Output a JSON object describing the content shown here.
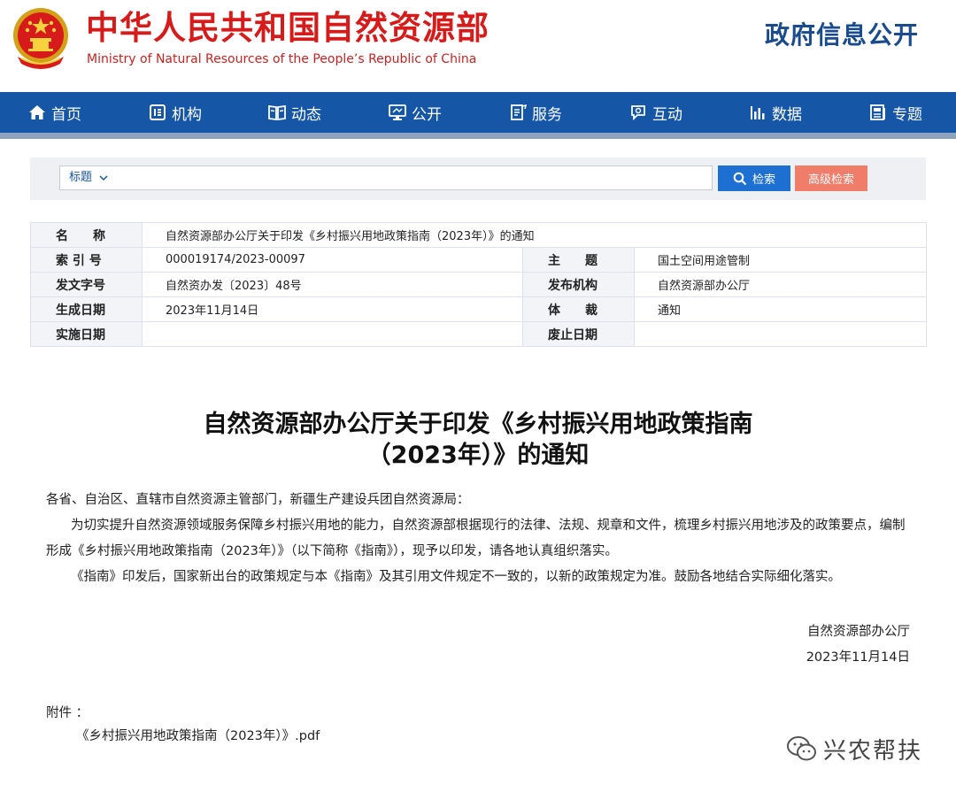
{
  "header": {
    "title_cn": "中华人民共和国自然资源部",
    "title_en": "Ministry of Natural Resources of the People’s Republic of China",
    "gov_info": "政府信息公开"
  },
  "nav": {
    "items": [
      {
        "label": "首页",
        "icon": "home-icon"
      },
      {
        "label": "机构",
        "icon": "org-icon"
      },
      {
        "label": "动态",
        "icon": "book-icon"
      },
      {
        "label": "公开",
        "icon": "monitor-icon"
      },
      {
        "label": "服务",
        "icon": "document-icon"
      },
      {
        "label": "互动",
        "icon": "chat-icon"
      },
      {
        "label": "数据",
        "icon": "bar-chart-icon"
      },
      {
        "label": "专题",
        "icon": "topic-icon"
      }
    ]
  },
  "search": {
    "select_value": "标题",
    "input_value": "",
    "search_label": "检索",
    "advanced_label": "高级检索"
  },
  "meta": {
    "name_label": "名　　称",
    "name_value": "自然资源部办公厅关于印发《乡村振兴用地政策指南（2023年）》的通知",
    "index_label": "索 引 号",
    "index_value": "000019174/2023-00097",
    "subject_label": "主　　题",
    "subject_value": "国土空间用途管制",
    "docno_label": "发文字号",
    "docno_value": "自然资办发〔2023〕48号",
    "issuer_label": "发布机构",
    "issuer_value": "自然资源部办公厅",
    "created_label": "生成日期",
    "created_value": "2023年11月14日",
    "genre_label": "体　　裁",
    "genre_value": "通知",
    "effective_label": "实施日期",
    "effective_value": "",
    "expiry_label": "废止日期",
    "expiry_value": ""
  },
  "article": {
    "title_line1": "自然资源部办公厅关于印发《乡村振兴用地政策指南",
    "title_line2": "（2023年）》的通知",
    "salutation": "各省、自治区、直辖市自然资源主管部门，新疆生产建设兵团自然资源局：",
    "para1_line1": "为切实提升自然资源领域服务保障乡村振兴用地的能力，自然资源部根据现行的法律、法规、规章和文件，梳理乡村振兴用地涉及的政策要点，编制",
    "para1_line2": "形成《乡村振兴用地政策指南（2023年）》（以下简称《指南》），现予以印发，请各地认真组织落实。",
    "para2": "《指南》印发后，国家新出台的政策规定与本《指南》及其引用文件规定不一致的，以新的政策规定为准。鼓励各地结合实际细化落实。",
    "sign_org": "自然资源部办公厅",
    "sign_date": "2023年11月14日",
    "attachment_label": "附件 ：",
    "attachment_file": "《乡村振兴用地政策指南（2023年）》.pdf"
  },
  "watermark": {
    "text": "兴农帮扶"
  },
  "colors": {
    "brand_red": "#d71a1a",
    "nav_blue": "#1656a6",
    "search_blue": "#1d6fd1",
    "advanced_coral": "#f07c6a"
  }
}
